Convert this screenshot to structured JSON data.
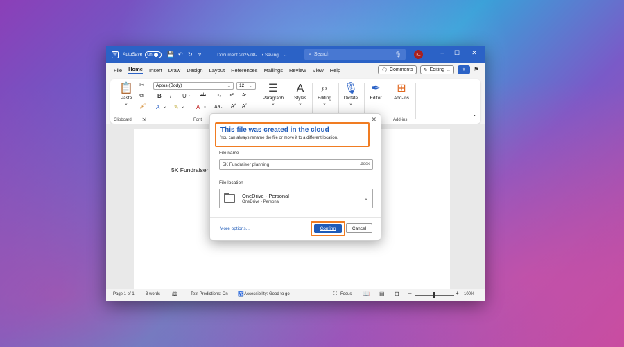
{
  "titlebar": {
    "autosave_label": "AutoSave",
    "autosave_state": "On",
    "doc_title": "Document 2025-08-... • Saving... ⌄",
    "search_placeholder": "Search",
    "avatar_initials": "KL"
  },
  "menubar": {
    "items": [
      "File",
      "Home",
      "Insert",
      "Draw",
      "Design",
      "Layout",
      "References",
      "Mailings",
      "Review",
      "View",
      "Help"
    ],
    "active": "Home",
    "comments_label": "Comments",
    "editing_label": "Editing"
  },
  "ribbon": {
    "clipboard": {
      "paste_label": "Paste",
      "group_label": "Clipboard"
    },
    "font": {
      "font_name": "Aptos (Body)",
      "font_size": "12",
      "group_label": "Font"
    },
    "paragraph_label": "Paragraph",
    "styles_label": "Styles",
    "editing_label": "Editing",
    "dictate_label": "Dictate",
    "editor_label": "Editor",
    "addins_label": "Add-ins",
    "addins_group_label": "Add-ins"
  },
  "document": {
    "text": "5K Fundraiser"
  },
  "dialog": {
    "title": "This file was created in the cloud",
    "subtitle": "You can always rename the file or move it to a different location.",
    "filename_label": "File name",
    "filename_value": "5K Fundraiser planning",
    "filename_ext": ".docx",
    "location_label": "File location",
    "location_primary": "OneDrive - Personal",
    "location_secondary": "OneDrive - Personal",
    "more_options": "More options...",
    "confirm_label": "Confirm",
    "cancel_label": "Cancel"
  },
  "statusbar": {
    "page": "Page 1 of 1",
    "words": "3 words",
    "text_predictions": "Text Predictions: On",
    "accessibility": "Accessibility: Good to go",
    "focus": "Focus",
    "zoom": "100%"
  },
  "colors": {
    "accent": "#2b62c6",
    "highlight": "#f07c22",
    "dialog_title": "#1f5bb8"
  }
}
